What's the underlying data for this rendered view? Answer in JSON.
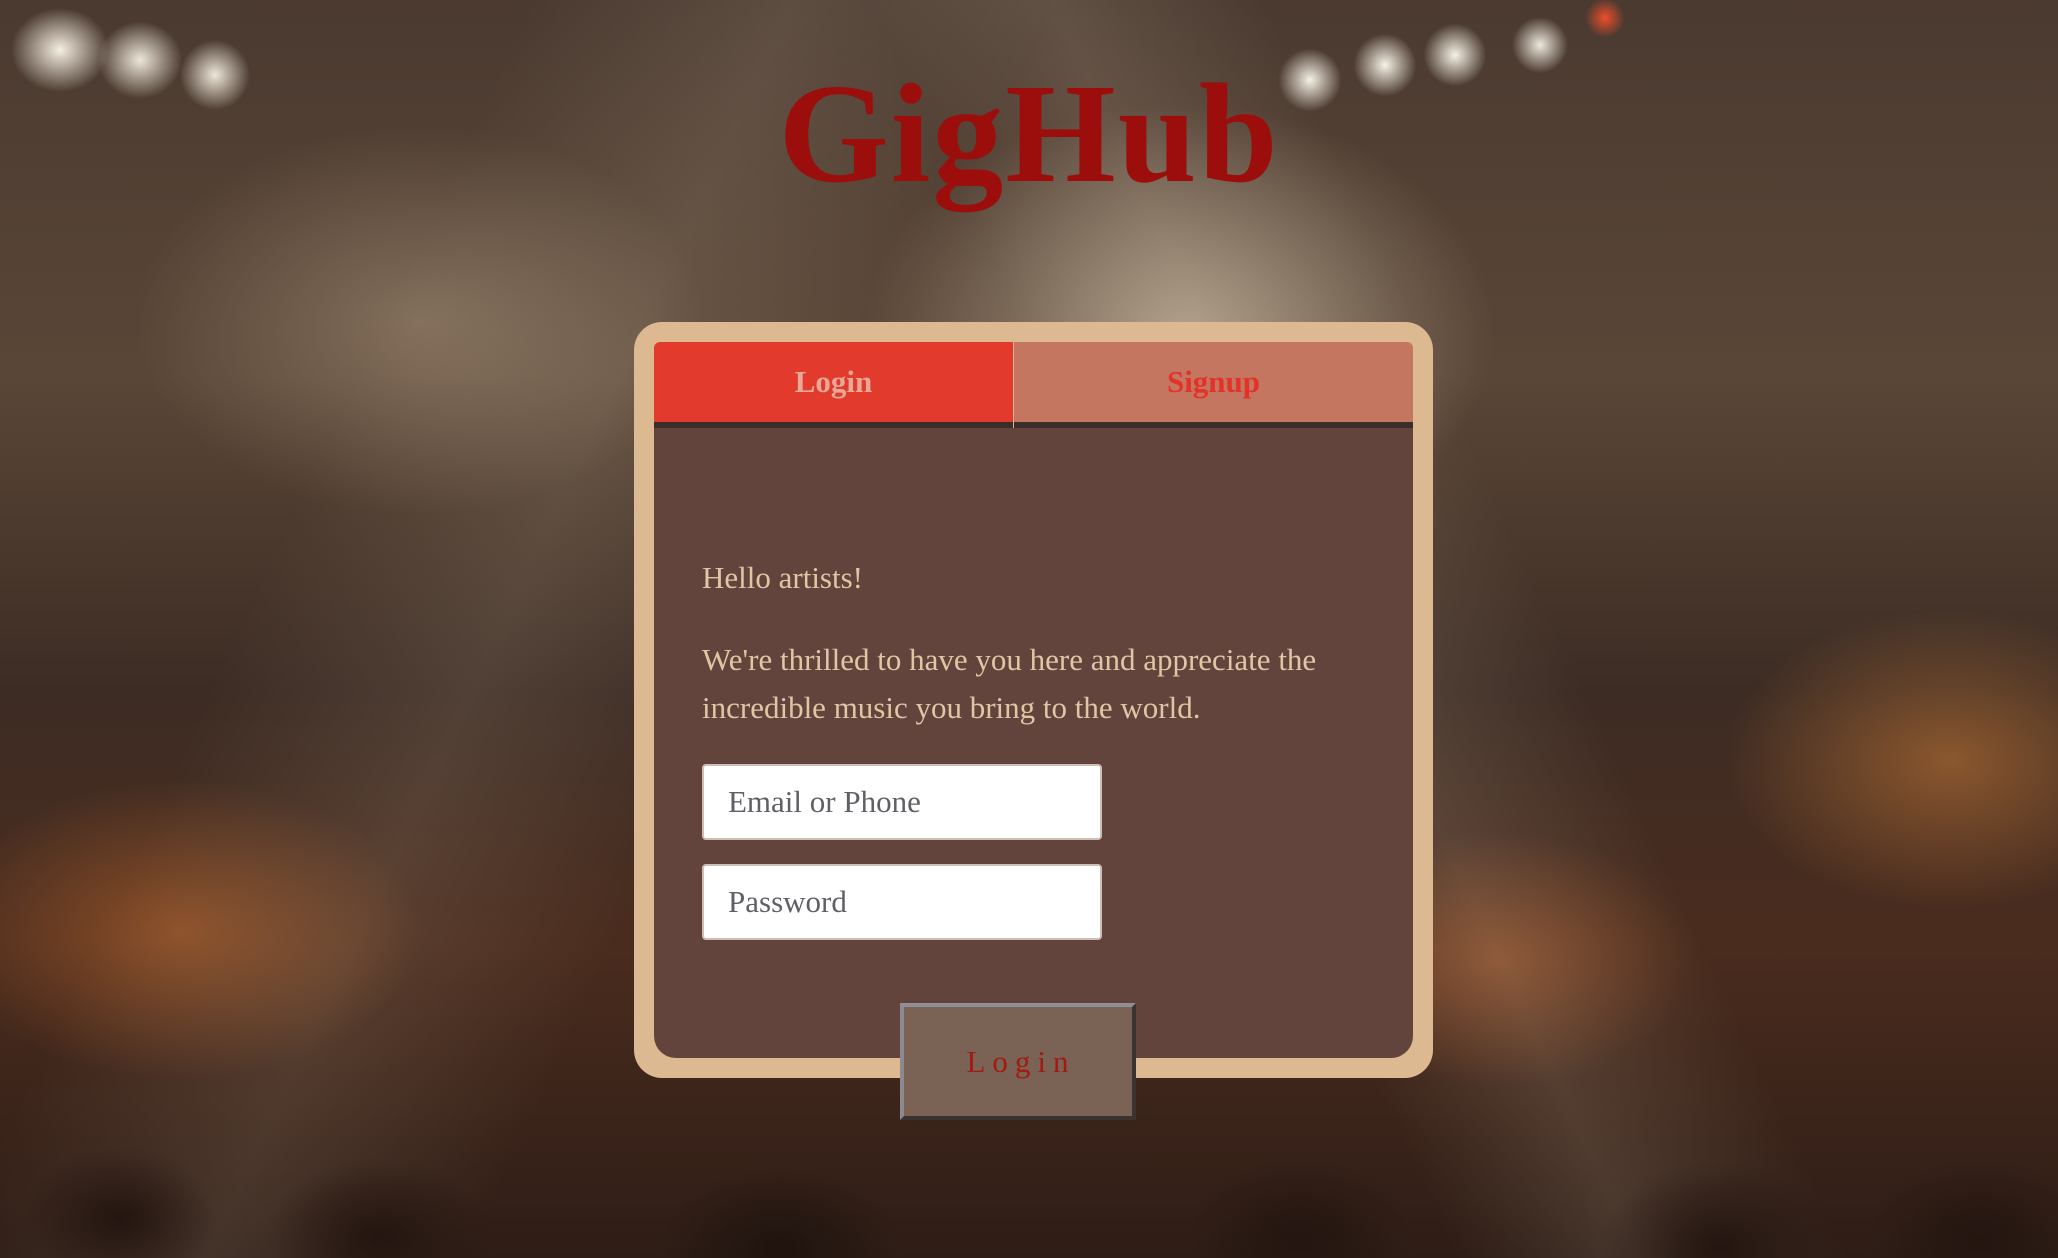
{
  "app": {
    "brand": "GigHub"
  },
  "tabs": {
    "login_label": "Login",
    "signup_label": "Signup",
    "active": "Login"
  },
  "form": {
    "greeting": "Hello artists!",
    "intro": "We're thrilled to have you here and appreciate the incredible music you bring to the world.",
    "email_placeholder": "Email or Phone",
    "email_value": "",
    "password_placeholder": "Password",
    "password_value": "",
    "submit_label": "Login"
  },
  "colors": {
    "brand": "#9c0e0c",
    "card_border": "#dcb991",
    "panel": "#62443d",
    "tab_login_bg": "#e33a2e",
    "tab_signup_bg": "#c47660",
    "text_light": "#e2c5a4",
    "button_bg": "#7a6355",
    "button_text": "#a31a14"
  }
}
